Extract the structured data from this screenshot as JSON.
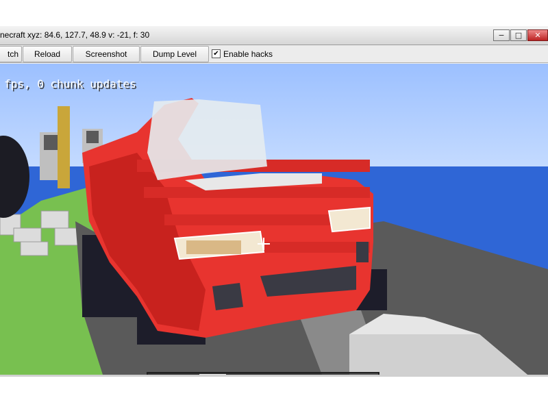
{
  "window": {
    "title": "necraft  xyz: 84.6, 127.7, 48.9  v: -21, f: 30",
    "controls": {
      "minimize": "−",
      "maximize": "□",
      "close": "✕"
    }
  },
  "toolbar": {
    "buttons": [
      "tch",
      "Reload",
      "Screenshot",
      "Dump Level"
    ],
    "enable_hacks": {
      "label": "Enable hacks",
      "checked": true,
      "mark": "✔"
    }
  },
  "hud": {
    "line1": "",
    "line2": "fps, 0 chunk updates"
  },
  "hotbar": {
    "selected_index": 2,
    "slots": [
      {
        "name": "gold-block",
        "top": "#f5d23a",
        "front": "#d89b12"
      },
      {
        "name": "rose",
        "top": "#3f7a2a",
        "front": "#b22"
      },
      {
        "name": "iron-block",
        "top": "#f2f2f2",
        "front": "#cfcfcf"
      },
      {
        "name": "orange-wool",
        "top": "#f08a28",
        "front": "#d46e16"
      },
      {
        "name": "wood-log",
        "top": "#9b7a4a",
        "front": "#6a4f2c"
      },
      {
        "name": "glass",
        "top": "#e8f0e0",
        "front": "#2f3826"
      },
      {
        "name": "diamond-block",
        "top": "#7ff0f0",
        "front": "#3ab9c4"
      },
      {
        "name": "bedrock",
        "top": "#5a5a5a",
        "front": "#3a3a3a"
      },
      {
        "name": "stone-slab",
        "top": "#c8c8c8",
        "front": "#8c8c8c"
      }
    ]
  },
  "colors": {
    "sky": "#9cc0ff",
    "water": "#2f66d6",
    "grass": "#78c050",
    "road": "#555555",
    "car_red": "#e8342f",
    "tire": "#1d1d2a"
  }
}
